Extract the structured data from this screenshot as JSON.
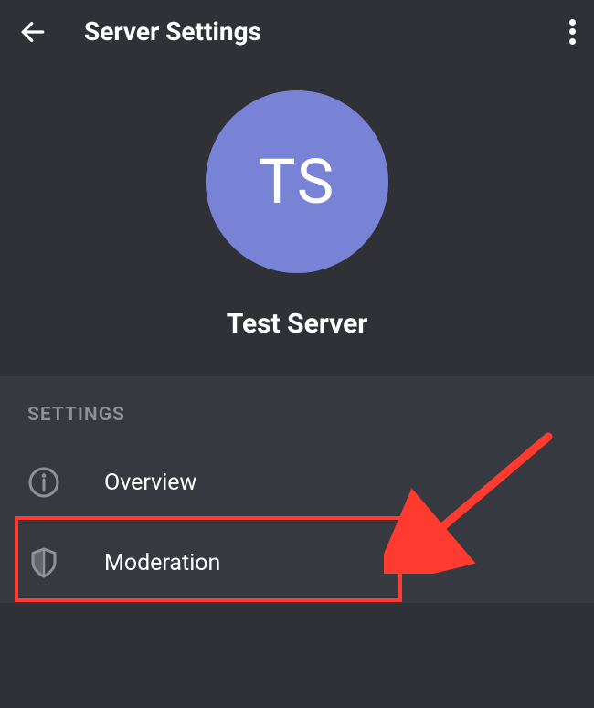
{
  "header": {
    "title": "Server Settings"
  },
  "server": {
    "avatar_initials": "TS",
    "name": "Test Server"
  },
  "settings": {
    "section_label": "SETTINGS",
    "items": [
      {
        "label": "Overview"
      },
      {
        "label": "Moderation"
      }
    ]
  }
}
